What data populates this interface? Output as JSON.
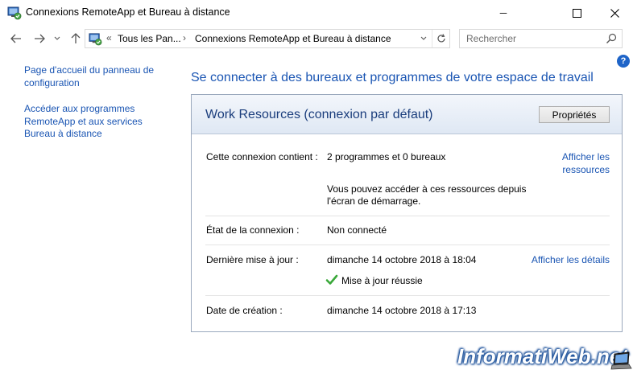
{
  "window": {
    "title": "Connexions RemoteApp et Bureau à distance",
    "minimize_glyph": "─",
    "maximize_glyph": "☐",
    "close_glyph": "✕"
  },
  "navigation": {
    "back_glyph": "←",
    "forward_glyph": "→",
    "recent_glyph": "˅",
    "up_glyph": "↑",
    "overflow": "«",
    "breadcrumb": [
      "Tous les Pan...",
      "Connexions RemoteApp et Bureau à distance"
    ],
    "breadcrumb_separator": "›",
    "dropdown_glyph": "˅",
    "refresh_glyph": "⟳"
  },
  "search": {
    "placeholder": "Rechercher"
  },
  "help": {
    "glyph": "?"
  },
  "sidebar": {
    "items": [
      {
        "label": "Page d'accueil du panneau de\nconfiguration"
      },
      {
        "label": "Accéder aux programmes\nRemoteApp et aux services\nBureau à distance"
      }
    ]
  },
  "main": {
    "heading": "Se connecter à des bureaux et programmes de votre espace de travail",
    "connection": {
      "name": "Work Resources (connexion par défaut)",
      "properties_button": "Propriétés",
      "contains_label": "Cette connexion contient :",
      "contains_value": "2 programmes et 0 bureaux",
      "show_resources_link": "Afficher les\nressources",
      "access_note_line1": "Vous pouvez accéder à ces ressources depuis",
      "access_note_line2": "l'écran de démarrage.",
      "status_label": "État de la connexion :",
      "status_value": "Non connecté",
      "last_update_label": "Dernière mise à jour :",
      "last_update_value": "dimanche 14 octobre 2018 à 18:04",
      "show_details_link": "Afficher les détails",
      "update_result": "Mise à jour réussie",
      "created_label": "Date de création :",
      "created_value": "dimanche 14 octobre 2018 à 17:13"
    }
  },
  "watermark": {
    "text": "InformatiWeb.net"
  },
  "colors": {
    "link": "#1a55b3",
    "panel_title": "#1a3d7c",
    "success": "#3aa83a"
  }
}
